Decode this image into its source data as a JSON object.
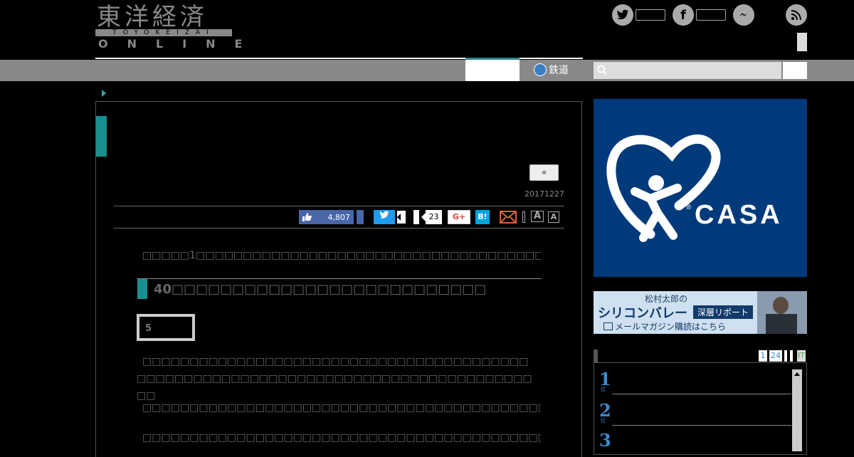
{
  "header": {
    "logo_jp": "東洋経済",
    "logo_band": "TOYOKEIZAI",
    "logo_online": "ONLINE"
  },
  "nav": {
    "rail_label": "鉄道"
  },
  "article": {
    "prev_label": "«",
    "date": "20171227",
    "like_count": "4,807",
    "share_count": "23",
    "gplus_label": "G+",
    "hatena_label": "B!",
    "font_large": "A",
    "font_small": "A",
    "lead": "□□□□□1□□□□□□□□□□□□□□□□□□□□□□□□□□□□□□□□□□□□□□□□□□□□□□□□□□□□□□",
    "heading": "40□□□□□□□□□□□□□□□□□□□□□□□□□□",
    "page_label": "5",
    "para1": "□□□□□□□□□□□□□□□□□□□□□□□□□□□□□□□□□□□□□□□□□□□□□□□□□□□□□□□□□□□□□□□□□□□□□□□□□□□□□□□□□□□□□",
    "para2": "□□□□□□□□□□□□□□□□□□□□□□□□□□□□□□□□□□□□□□□□□□□□□□□□□□□□□□□□□□□□",
    "para3": "□□□□□□□□□□□□□□□□□□□□□□□□□□□□□□□□□□□□□□□□□□□□□□□□□□□□□□□□□□□□□□"
  },
  "sidebar": {
    "ad_brand": "CASA",
    "ad_reg": "®",
    "banner_top": "松村太郎の",
    "banner_main": "シリコンバレー",
    "banner_tag": "深層リポート",
    "banner_sub": "メールマガジン購読はこちら",
    "rank_tabs": [
      "1",
      "24",
      "",
      "",
      "IT"
    ],
    "rank_numbers": [
      "1",
      "2",
      "3"
    ],
    "rank_suffix": "位"
  }
}
